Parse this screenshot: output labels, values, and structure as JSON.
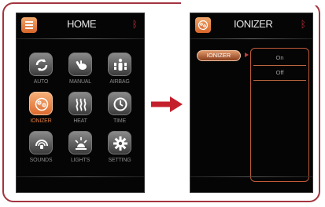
{
  "home": {
    "title": "HOME",
    "tiles": [
      {
        "label": "AUTO",
        "icon": "auto-cycle-icon"
      },
      {
        "label": "MANUAL",
        "icon": "manual-hand-icon"
      },
      {
        "label": "AIRBAG",
        "icon": "airbag-body-icon"
      },
      {
        "label": "IONIZER",
        "icon": "ionizer-icon",
        "active": true
      },
      {
        "label": "HEAT",
        "icon": "heat-waves-icon"
      },
      {
        "label": "TIME",
        "icon": "clock-icon"
      },
      {
        "label": "SOUNDS",
        "icon": "sound-icon"
      },
      {
        "label": "LIGHTS",
        "icon": "light-bulb-icon"
      },
      {
        "label": "SETTING",
        "icon": "gear-icon"
      }
    ]
  },
  "ionizer": {
    "title": "IONIZER",
    "menu_label": "IONIZER",
    "options": [
      "On",
      "Off"
    ]
  },
  "colors": {
    "accent_orange": "#dd6a2e",
    "frame_red": "#a3343f",
    "arrow_red": "#c4202c",
    "bluetooth_red": "#c4303a"
  }
}
